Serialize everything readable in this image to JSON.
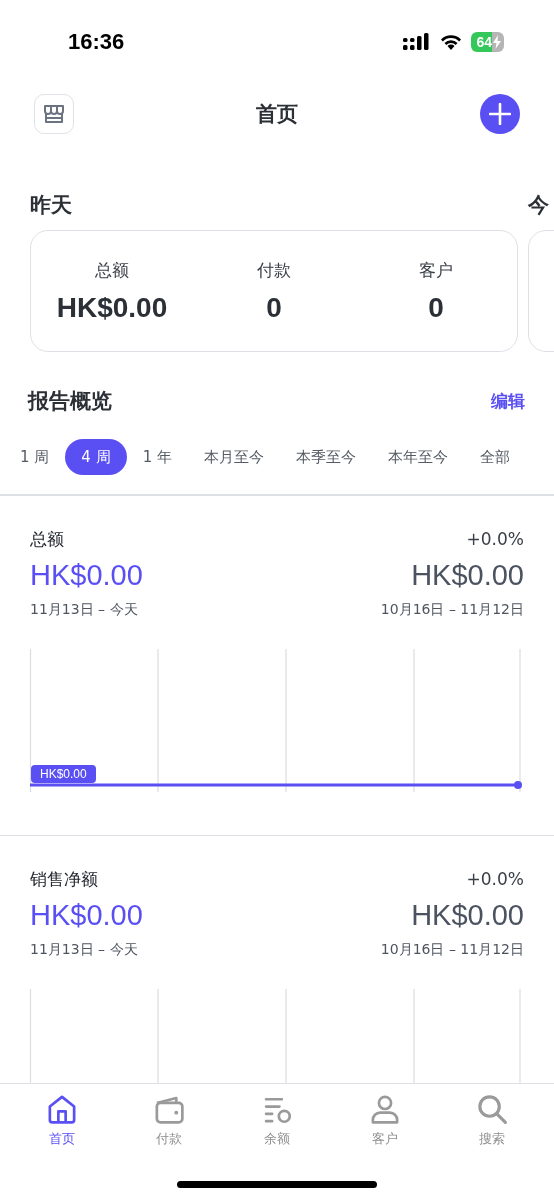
{
  "status_bar": {
    "time": "16:36",
    "battery": "64"
  },
  "header": {
    "title": "首页"
  },
  "days": [
    {
      "title": "昨天",
      "stats": [
        {
          "label": "总额",
          "value": "HK$0.00"
        },
        {
          "label": "付款",
          "value": "0"
        },
        {
          "label": "客户",
          "value": "0"
        }
      ]
    },
    {
      "title": "今"
    }
  ],
  "report": {
    "title": "报告概览",
    "edit": "编辑",
    "periods": [
      {
        "label": "1 周",
        "selected": false
      },
      {
        "label": "4 周",
        "selected": true
      },
      {
        "label": "1 年",
        "selected": false
      },
      {
        "label": "本月至今",
        "selected": false
      },
      {
        "label": "本季至今",
        "selected": false
      },
      {
        "label": "本年至今",
        "selected": false
      },
      {
        "label": "全部",
        "selected": false
      }
    ]
  },
  "metrics": [
    {
      "title": "总额",
      "change": "+0.0%",
      "current_value": "HK$0.00",
      "current_range": "11月13日 – 今天",
      "previous_value": "HK$0.00",
      "previous_range": "10月16日 – 11月12日",
      "marker_label": "HK$0.00"
    },
    {
      "title": "销售净额",
      "change": "+0.0%",
      "current_value": "HK$0.00",
      "current_range": "11月13日 – 今天",
      "previous_value": "HK$0.00",
      "previous_range": "10月16日 – 11月12日"
    }
  ],
  "tab_bar": [
    {
      "label": "首页",
      "selected": true
    },
    {
      "label": "付款",
      "selected": false
    },
    {
      "label": "余额",
      "selected": false
    },
    {
      "label": "客户",
      "selected": false
    },
    {
      "label": "搜索",
      "selected": false
    }
  ]
}
